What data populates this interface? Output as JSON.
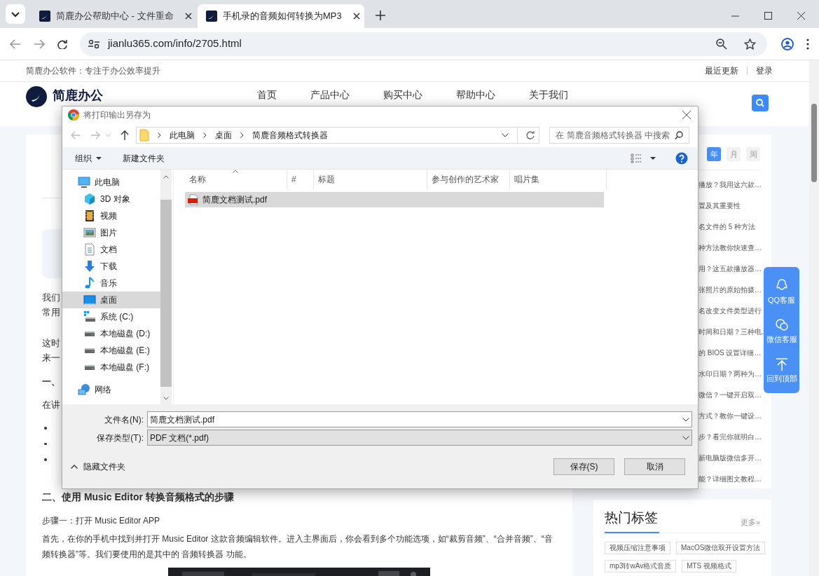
{
  "browser": {
    "tabs": [
      {
        "title": "简鹿办公帮助中心 - 文件重命",
        "selected": false
      },
      {
        "title": "手机录的音频如何转换为MP3",
        "selected": true
      }
    ],
    "url": "jianlu365.com/info/2705.html"
  },
  "site": {
    "slogan": "简鹿办公软件：专注于办公效率提升",
    "top_links": [
      "最近更新",
      "登录"
    ],
    "logo": "简鹿办公",
    "nav": [
      "首页",
      "产品中心",
      "购买中心",
      "帮助中心",
      "关于我们"
    ]
  },
  "article": {
    "fragments": [
      "我们",
      "常用",
      "这时",
      "来一",
      "一、",
      "在讲"
    ],
    "heading": "二、使用 Music Editor 转换音频格式的步骤",
    "step": "步骤一：打开 Music Editor APP",
    "paragraph": "首先，在你的手机中找到并打开 Music Editor 这款音频编辑软件。进入主界面后，你会看到多个功能选项，如“裁剪音频”、“合并音频”、“音频转换器”等。我们要使用的是其中的 音频转换器 功能。"
  },
  "sidebar": {
    "periods": [
      {
        "label": "年",
        "selected": true
      },
      {
        "label": "月",
        "selected": false
      },
      {
        "label": "周",
        "selected": false
      }
    ],
    "items": [
      "播放？我用这六款…",
      "置及其重要性",
      "名文件的 5 种方法",
      "种方法教你快速查…",
      "用？这五款播放器…",
      "张照片的原始拍摄…",
      "名改变文件类型进行",
      "时间和日期？三种电…",
      "的 BIOS 设置详细…",
      "水印日期？两种为…",
      "微信？一键开启双…",
      "方式？教你一键设…",
      "步？看完你就明白…",
      "新电脑版微信多开…",
      "能？详细图文教程…"
    ],
    "tags_title": "热门标签",
    "more": "更多»",
    "tags": [
      "视频压缩注意事项",
      "MacOS微信双开设置方法",
      "mp3转wAv格式音质",
      "MTS 视频格式"
    ]
  },
  "float_buttons": [
    "QQ客服",
    "微信客服",
    "回到顶部"
  ],
  "dialog": {
    "title": "将打印输出另存为",
    "path": [
      "此电脑",
      "桌面",
      "简鹿音频格式转换器"
    ],
    "search_placeholder": "在 简鹿音频格式转换器 中搜索",
    "toolbar": [
      "组织",
      "新建文件夹"
    ],
    "nav": [
      {
        "label": "此电脑",
        "selected": false,
        "children": [
          {
            "label": "3D 对象",
            "selected": false
          },
          {
            "label": "视频",
            "selected": false
          },
          {
            "label": "图片",
            "selected": false
          },
          {
            "label": "文档",
            "selected": false
          },
          {
            "label": "下载",
            "selected": false
          },
          {
            "label": "音乐",
            "selected": false
          },
          {
            "label": "桌面",
            "selected": true
          },
          {
            "label": "系统 (C:)",
            "selected": false
          },
          {
            "label": "本地磁盘 (D:)",
            "selected": false
          },
          {
            "label": "本地磁盘 (E:)",
            "selected": false
          },
          {
            "label": "本地磁盘 (F:)",
            "selected": false
          }
        ]
      },
      {
        "label": "网络",
        "selected": false
      }
    ],
    "columns": [
      "名称",
      "#",
      "标题",
      "参与创作的艺术家",
      "唱片集"
    ],
    "files": [
      {
        "name": "简鹿文档测试.pdf",
        "selected": true
      }
    ],
    "filename_label": "文件名(N):",
    "filename": "简鹿文档测试.pdf",
    "type_label": "保存类型(T):",
    "type": "PDF 文档(*.pdf)",
    "hide_folders": "隐藏文件夹",
    "buttons": [
      "保存(S)",
      "取消"
    ]
  }
}
